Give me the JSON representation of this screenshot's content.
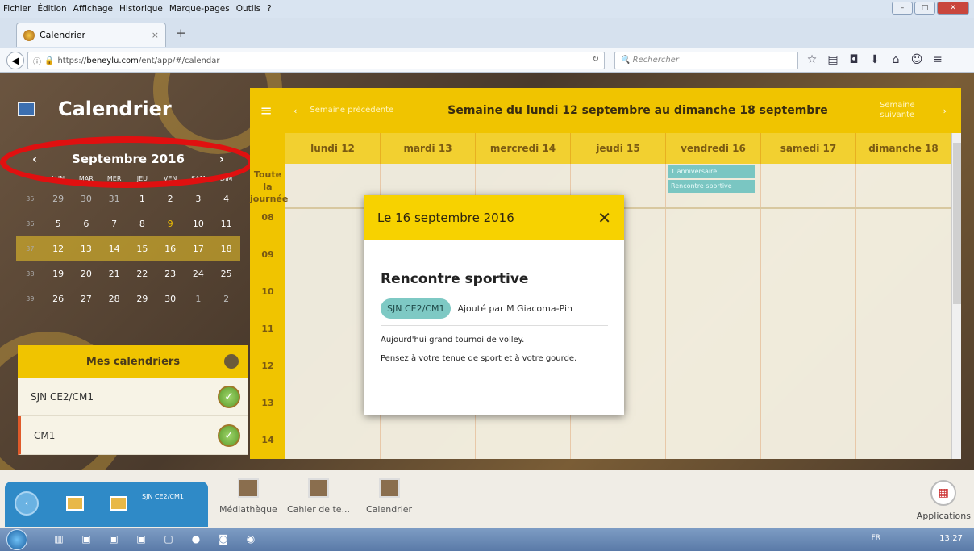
{
  "browser": {
    "menu": [
      "Fichier",
      "Édition",
      "Affichage",
      "Historique",
      "Marque-pages",
      "Outils",
      "?"
    ],
    "tab_title": "Calendrier",
    "url_prefix": "https://",
    "url_host": "beneylu.com",
    "url_path": "/ent/app/#/calendar",
    "search_placeholder": "Rechercher"
  },
  "sidebar": {
    "title": "Calendrier",
    "month": "Septembre 2016",
    "weekdays": [
      "LUN",
      "MAR",
      "MER",
      "JEU",
      "VEN",
      "SAM",
      "DIM"
    ],
    "weeks": [
      {
        "n": "35",
        "days": [
          "29",
          "30",
          "31",
          "1",
          "2",
          "3",
          "4"
        ]
      },
      {
        "n": "36",
        "days": [
          "5",
          "6",
          "7",
          "8",
          "9",
          "10",
          "11"
        ]
      },
      {
        "n": "37",
        "days": [
          "12",
          "13",
          "14",
          "15",
          "16",
          "17",
          "18"
        ]
      },
      {
        "n": "38",
        "days": [
          "19",
          "20",
          "21",
          "22",
          "23",
          "24",
          "25"
        ]
      },
      {
        "n": "39",
        "days": [
          "26",
          "27",
          "28",
          "29",
          "30",
          "1",
          "2"
        ]
      }
    ],
    "my_calendars_label": "Mes calendriers",
    "calendars": [
      "SJN CE2/CM1",
      "CM1"
    ]
  },
  "calendar": {
    "prev_label": "Semaine précédente",
    "next_label": "Semaine suivante",
    "title": "Semaine du lundi 12 septembre au dimanche 18 septembre",
    "days": [
      "lundi 12",
      "mardi 13",
      "mercredi 14",
      "jeudi 15",
      "vendredi 16",
      "samedi 17",
      "dimanche 18"
    ],
    "allday_label": "Toute la journée",
    "hours": [
      "08",
      "09",
      "10",
      "11",
      "12",
      "13",
      "14"
    ],
    "events": [
      "1 anniversaire",
      "Rencontre sportive"
    ]
  },
  "modal": {
    "date": "Le 16 septembre 2016",
    "title": "Rencontre sportive",
    "calendar_badge": "SJN CE2/CM1",
    "author": "Ajouté par M Giacoma-Pin",
    "line1": "Aujourd'hui grand tournoi de volley.",
    "line2": "Pensez à votre tenue de sport et à votre gourde."
  },
  "dock": {
    "group_label": "SJN CE2/CM1",
    "items": [
      "Médiathèque",
      "Cahier de te...",
      "Calendrier"
    ],
    "apps_label": "Applications"
  },
  "taskbar": {
    "lang": "FR",
    "time": "13:27"
  }
}
